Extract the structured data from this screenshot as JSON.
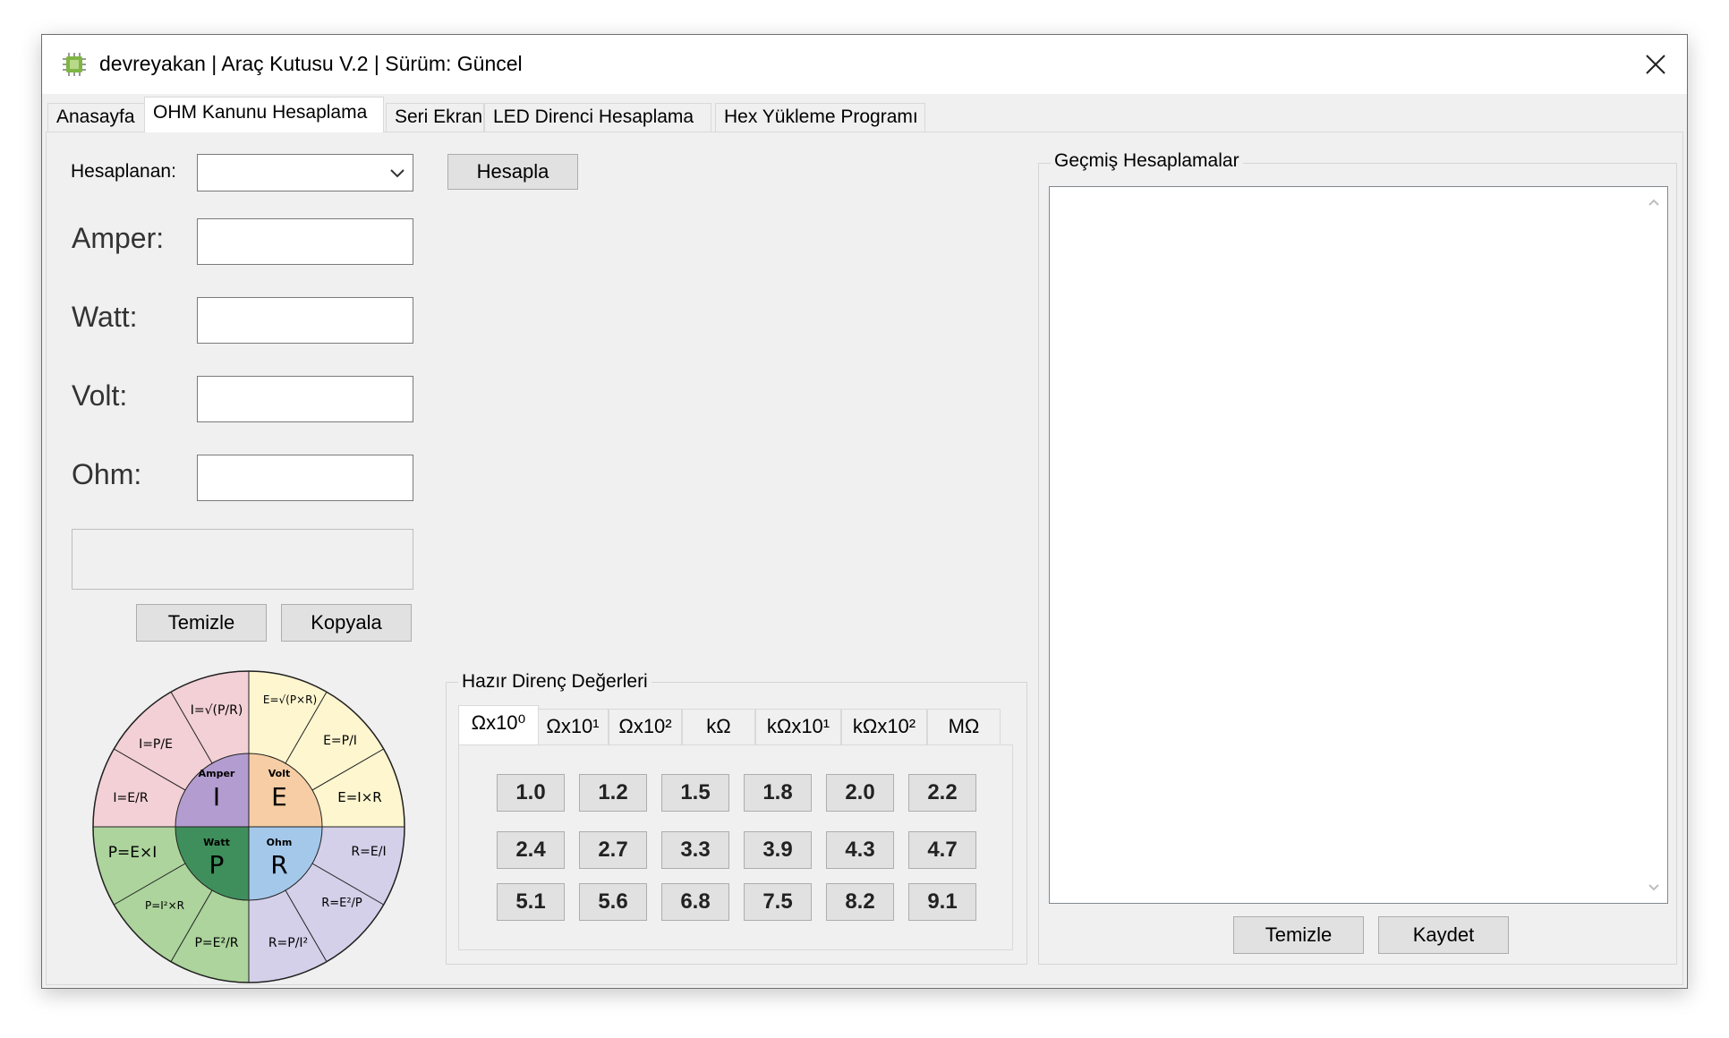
{
  "window": {
    "title": "devreyakan | Araç Kutusu V.2 | Sürüm: Güncel"
  },
  "tabs": [
    {
      "label": "Anasayfa"
    },
    {
      "label": "OHM Kanunu Hesaplama"
    },
    {
      "label": "Seri Ekran"
    },
    {
      "label": "LED Direnci Hesaplama"
    },
    {
      "label": "Hex Yükleme Programı"
    }
  ],
  "active_tab": "OHM Kanunu Hesaplama",
  "calc": {
    "selector_label": "Hesaplanan:",
    "selector_value": "",
    "calculate_button": "Hesapla",
    "fields": [
      {
        "label": "Amper:",
        "value": ""
      },
      {
        "label": "Watt:",
        "value": ""
      },
      {
        "label": "Volt:",
        "value": ""
      },
      {
        "label": "Ohm:",
        "value": ""
      }
    ],
    "result_text": "",
    "clear_button": "Temizle",
    "copy_button": "Kopyala"
  },
  "wheel": {
    "center": [
      {
        "small": "Amper",
        "big": "I",
        "color": "#b39ccf"
      },
      {
        "small": "Volt",
        "big": "E",
        "color": "#f6cda4"
      },
      {
        "small": "Watt",
        "big": "P",
        "color": "#3f8f5c"
      },
      {
        "small": "Ohm",
        "big": "R",
        "color": "#a4c8ea"
      }
    ],
    "colors": {
      "amper": "#f2d0d5",
      "volt": "#fdf6cf",
      "watt": "#acd49c",
      "ohm": "#d4d0ea"
    },
    "formulas": [
      "I=√(P/R)",
      "I=P/E",
      "I=E/R",
      "E=√(P×R)",
      "E=P/I",
      "E=I×R",
      "R=E/I",
      "R=E²/P",
      "R=P/I²",
      "P=E²/R",
      "P=I²×R",
      "P=E×I"
    ]
  },
  "presets": {
    "title": "Hazır Direnç Değerleri",
    "tabs": [
      {
        "label": "Ωx10⁰"
      },
      {
        "label": "Ωx10¹"
      },
      {
        "label": "Ωx10²"
      },
      {
        "label": "kΩ"
      },
      {
        "label": "kΩx10¹"
      },
      {
        "label": "kΩx10²"
      },
      {
        "label": "MΩ"
      }
    ],
    "active_tab": "Ωx10⁰",
    "values": [
      "1.0",
      "1.2",
      "1.5",
      "1.8",
      "2.0",
      "2.2",
      "2.4",
      "2.7",
      "3.3",
      "3.9",
      "4.3",
      "4.7",
      "5.1",
      "5.6",
      "6.8",
      "7.5",
      "8.2",
      "9.1"
    ]
  },
  "history": {
    "title": "Geçmiş Hesaplamalar",
    "clear_button": "Temizle",
    "save_button": "Kaydet"
  }
}
